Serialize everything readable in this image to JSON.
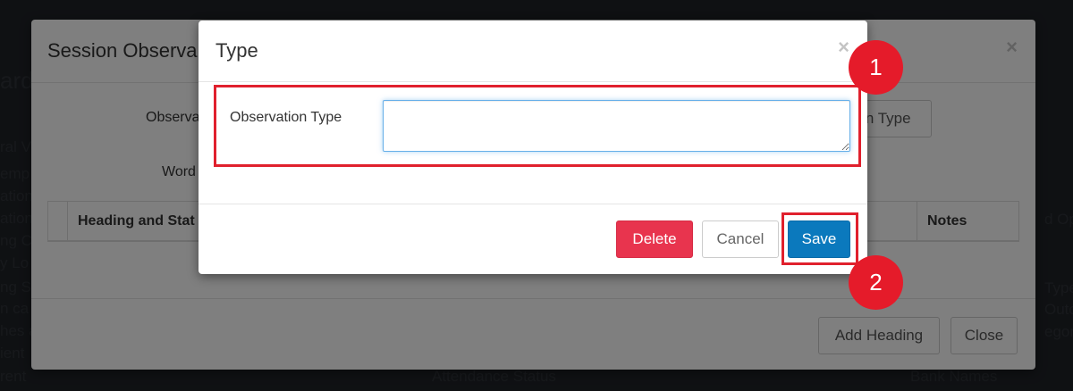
{
  "background": {
    "texts": [
      "ard",
      "ral V",
      "emp",
      "ation",
      "ation",
      "ng C",
      "y Lo",
      "ng S",
      "n ca",
      "hes a",
      "ient",
      "rent",
      "Attendance Status",
      "Bank Names",
      "d Op",
      "Type",
      "Outc",
      "egor"
    ]
  },
  "outer_modal": {
    "title": "Session Observa",
    "close_glyph": "×",
    "field_label_1": "Observa",
    "field_label_2": "Word",
    "side_button_label": "on Type",
    "table": {
      "headers": [
        "Heading and Stat",
        "Notes"
      ]
    },
    "footer": {
      "add_heading_label": "Add Heading",
      "close_label": "Close"
    }
  },
  "inner_modal": {
    "title": "Type",
    "close_glyph": "×",
    "field_label": "Observation Type",
    "field_value": "",
    "footer": {
      "delete_label": "Delete",
      "cancel_label": "Cancel",
      "save_label": "Save"
    }
  },
  "annotations": {
    "badge_1": "1",
    "badge_2": "2",
    "color": "#e0202d"
  },
  "colors": {
    "delete": "#e8344e",
    "save": "#0b79bd",
    "focus_border": "#66afe9"
  }
}
